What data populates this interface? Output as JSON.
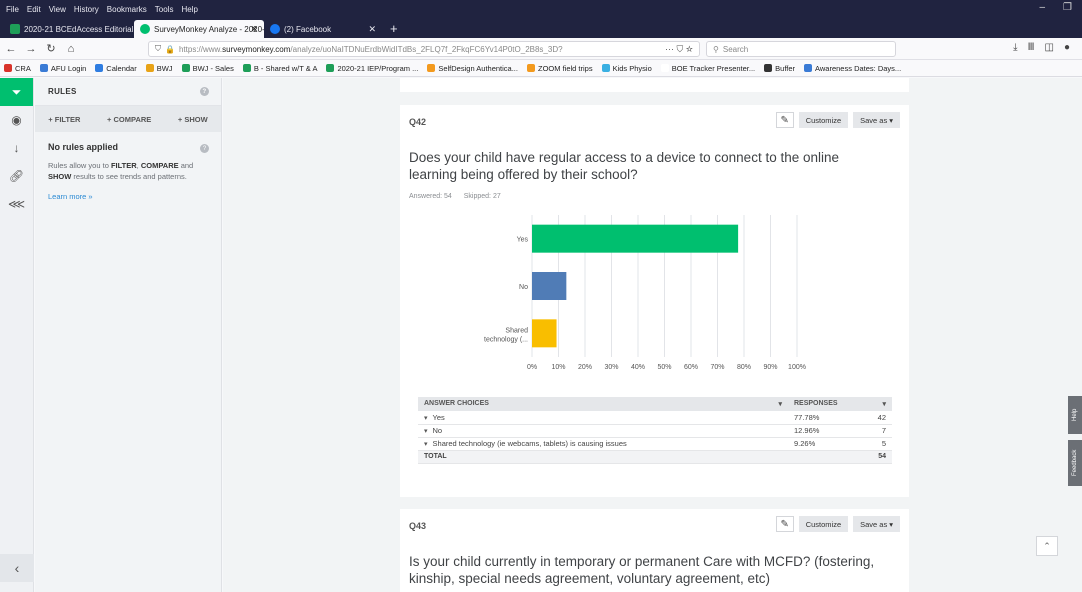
{
  "browser": {
    "menu": [
      "File",
      "Edit",
      "View",
      "History",
      "Bookmarks",
      "Tools",
      "Help"
    ],
    "tabs": [
      {
        "title": "2020-21 BCEdAccess Editorial ×",
        "color": "#1e9e58",
        "active": false
      },
      {
        "title": "SurveyMonkey Analyze - 2020-",
        "color": "#00bf6f",
        "active": true
      },
      {
        "title": "(2) Facebook",
        "color": "#1877f2",
        "active": false
      }
    ],
    "url_prefix": "https://www.",
    "url_host": "surveymonkey.com",
    "url_path": "/analyze/uoNaITDNuErdbWidITdBs_2FLQ7f_2FkqFC6Yv14P0tO_2B8s_3D?",
    "search_placeholder": "Search",
    "bookmarks": [
      {
        "label": "CRA",
        "color": "#d8332a"
      },
      {
        "label": "AFU Login",
        "color": "#3a7bd5"
      },
      {
        "label": "Calendar",
        "color": "#2f7de1"
      },
      {
        "label": "BWJ",
        "color": "#e8a317"
      },
      {
        "label": "BWJ - Sales",
        "color": "#1e9e58"
      },
      {
        "label": "B - Shared w/T & A",
        "color": "#1e9e58"
      },
      {
        "label": "2020-21 IEP/Program ...",
        "color": "#1e9e58"
      },
      {
        "label": "SelfDesign Authentica...",
        "color": "#f39a1e"
      },
      {
        "label": "ZOOM field trips",
        "color": "#f39a1e"
      },
      {
        "label": "Kids Physio",
        "color": "#3ab0e2"
      },
      {
        "label": "BOE Tracker Presenter...",
        "color": "#ffffff"
      },
      {
        "label": "Buffer",
        "color": "#333333"
      },
      {
        "label": "Awareness Dates: Days...",
        "color": "#3a7bd5"
      }
    ]
  },
  "rules": {
    "header": "RULES",
    "actions": [
      "+ FILTER",
      "+ COMPARE",
      "+ SHOW"
    ],
    "title": "No rules applied",
    "desc_prefix": "Rules allow you to ",
    "desc_filter": "FILTER",
    "desc_sep1": ", ",
    "desc_compare": "COMPARE",
    "desc_sep2": " and ",
    "desc_show": "SHOW",
    "desc_suffix": " results to see trends and patterns.",
    "learn_more": "Learn more »"
  },
  "q42": {
    "number": "Q42",
    "customize": "Customize",
    "save_as": "Save as",
    "title": "Does your child have regular access to a device to connect to the online learning being offered by their school?",
    "answered": "Answered: 54",
    "skipped": "Skipped: 27",
    "table": {
      "col_choices": "ANSWER CHOICES",
      "col_responses": "RESPONSES",
      "rows": [
        {
          "label": "Yes",
          "pct": "77.78%",
          "count": "42"
        },
        {
          "label": "No",
          "pct": "12.96%",
          "count": "7"
        },
        {
          "label": "Shared technology (ie webcams, tablets) is causing issues",
          "pct": "9.26%",
          "count": "5"
        }
      ],
      "total_label": "TOTAL",
      "total_count": "54"
    }
  },
  "q43": {
    "number": "Q43",
    "customize": "Customize",
    "save_as": "Save as",
    "title": "Is your child currently in temporary or permanent Care with MCFD? (fostering, kinship, special needs agreement, voluntary agreement, etc)"
  },
  "side_tabs": {
    "help": "Help",
    "feedback": "Feedback"
  },
  "chart_data": {
    "type": "bar",
    "orientation": "horizontal",
    "categories": [
      "Yes",
      "No",
      "Shared technology (..."
    ],
    "values": [
      77.78,
      12.96,
      9.26
    ],
    "colors": [
      "#00bf6f",
      "#507cb6",
      "#f9be00"
    ],
    "xticks": [
      "0%",
      "10%",
      "20%",
      "30%",
      "40%",
      "50%",
      "60%",
      "70%",
      "80%",
      "90%",
      "100%"
    ],
    "xlim": [
      0,
      100
    ],
    "grid": true
  }
}
